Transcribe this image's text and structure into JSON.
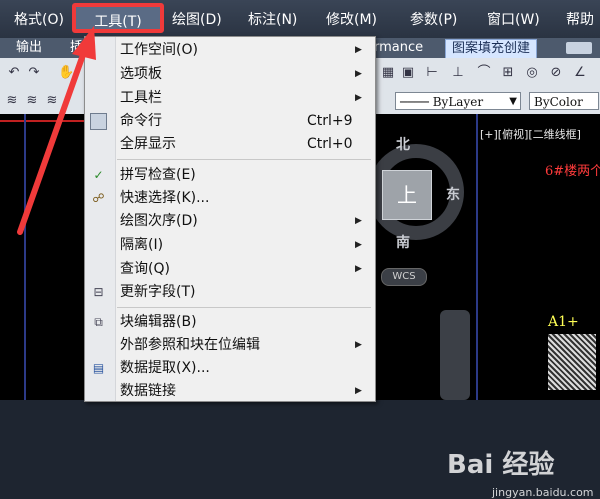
{
  "menubar": {
    "items": [
      "格式(O)",
      "工具(T)",
      "绘图(D)",
      "标注(N)",
      "修改(M)",
      "参数(P)",
      "窗口(W)",
      "帮助"
    ]
  },
  "ribbon": {
    "tabs": [
      "输出",
      "插",
      "rmance",
      "图案填充创建"
    ]
  },
  "toolbar": {
    "layer_combo": "ByLayer",
    "color_combo": "ByColor"
  },
  "canvas": {
    "view_label": "[+][俯视][二维线框]",
    "red_text": "6#楼两个",
    "yellow_text": "A1+",
    "viewcube_top": "上",
    "compass": {
      "north": "北",
      "east": "东",
      "south": "南"
    },
    "wcs": "WCS",
    "watermark": "Bai 经验",
    "watermark_sub": "jingyan.baidu.com"
  },
  "menu": {
    "items": [
      {
        "label": "工作空间(O)",
        "shortcut": "",
        "submenu": true,
        "icon": ""
      },
      {
        "label": "选项板",
        "shortcut": "",
        "submenu": true,
        "icon": ""
      },
      {
        "label": "工具栏",
        "shortcut": "",
        "submenu": true,
        "icon": ""
      },
      {
        "label": "命令行",
        "shortcut": "Ctrl+9",
        "submenu": false,
        "icon": "command-line-icon"
      },
      {
        "label": "全屏显示",
        "shortcut": "Ctrl+0",
        "submenu": false,
        "icon": ""
      },
      {
        "label": "拼写检查(E)",
        "shortcut": "",
        "submenu": false,
        "icon": "spellcheck-icon"
      },
      {
        "label": "快速选择(K)...",
        "shortcut": "",
        "submenu": false,
        "icon": "quick-select-icon"
      },
      {
        "label": "绘图次序(D)",
        "shortcut": "",
        "submenu": true,
        "icon": ""
      },
      {
        "label": "隔离(I)",
        "shortcut": "",
        "submenu": true,
        "icon": ""
      },
      {
        "label": "查询(Q)",
        "shortcut": "",
        "submenu": true,
        "icon": ""
      },
      {
        "label": "更新字段(T)",
        "shortcut": "",
        "submenu": false,
        "icon": "update-fields-icon"
      },
      {
        "label": "块编辑器(B)",
        "shortcut": "",
        "submenu": false,
        "icon": "block-editor-icon"
      },
      {
        "label": "外部参照和块在位编辑",
        "shortcut": "",
        "submenu": true,
        "icon": ""
      },
      {
        "label": "数据提取(X)...",
        "shortcut": "",
        "submenu": false,
        "icon": "data-extraction-icon"
      },
      {
        "label": "数据链接",
        "shortcut": "",
        "submenu": true,
        "icon": ""
      }
    ]
  },
  "colors": {
    "highlight_border": "#f03a3a",
    "menubar_bg": "#2f3a4a",
    "menu_bg": "#f0f0f0"
  }
}
